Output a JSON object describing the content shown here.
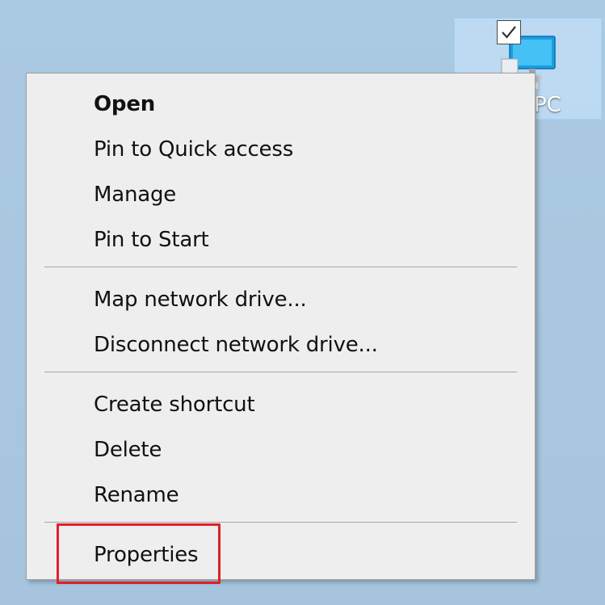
{
  "desktop": {
    "icon": {
      "label": "PC",
      "icon_name": "this-pc-icon",
      "selected": true,
      "checkbox_checked": true
    }
  },
  "context_menu": {
    "items": [
      {
        "label": "Open",
        "bold": true
      },
      {
        "label": "Pin to Quick access",
        "bold": false
      },
      {
        "label": "Manage",
        "bold": false
      },
      {
        "label": "Pin to Start",
        "bold": false
      },
      {
        "label": "Map network drive...",
        "bold": false
      },
      {
        "label": "Disconnect network drive...",
        "bold": false
      },
      {
        "label": "Create shortcut",
        "bold": false
      },
      {
        "label": "Delete",
        "bold": false
      },
      {
        "label": "Rename",
        "bold": false
      },
      {
        "label": "Properties",
        "bold": false,
        "highlighted": true
      }
    ]
  },
  "colors": {
    "desktop_background": "#a9c7e0",
    "menu_background": "#eeeeee",
    "highlight_border": "#e02027",
    "selection_fill": "#cce8ff"
  }
}
